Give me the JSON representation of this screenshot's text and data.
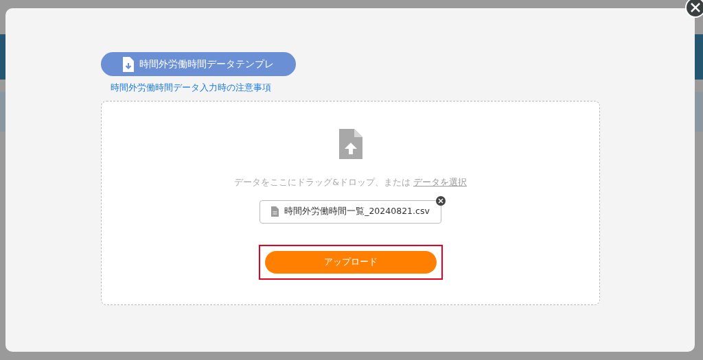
{
  "modal": {
    "template_button": {
      "label": "時間外労働時間データテンプレ"
    },
    "notes_link": {
      "label": "時間外労働時間データ入力時の注意事項"
    },
    "dropzone": {
      "prompt": "データをここにドラッグ&ドロップ、または",
      "select_link": "データを選択",
      "file": {
        "name": "時間外労働時間一覧_20240821.csv"
      }
    },
    "upload_button": {
      "label": "アップロード",
      "highlighted": true
    }
  }
}
